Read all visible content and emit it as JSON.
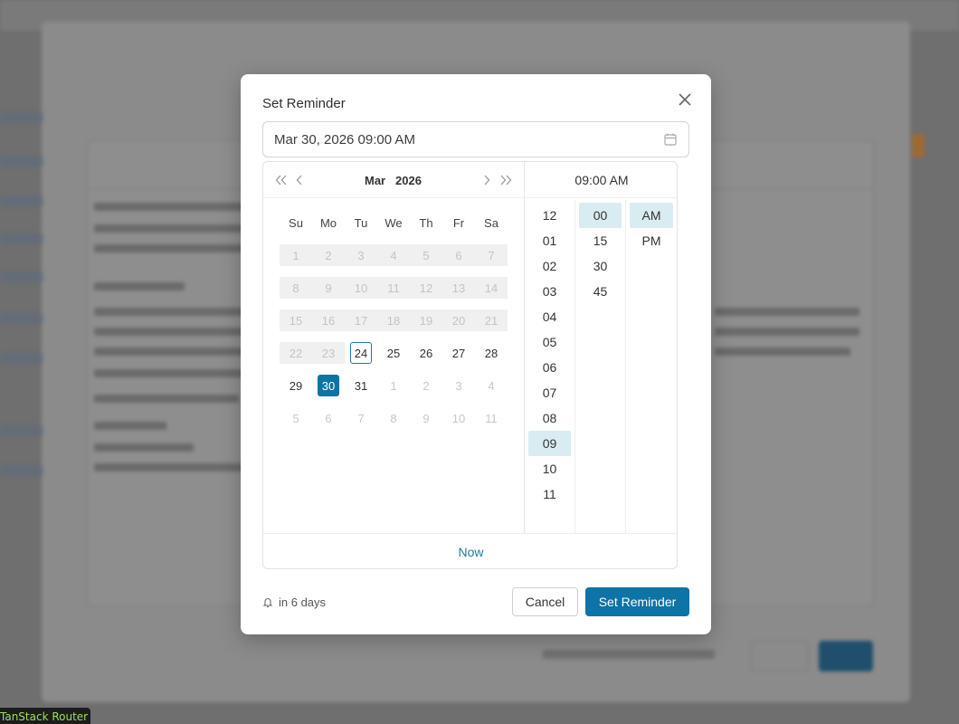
{
  "background": {
    "router_badge": "TanStack Router"
  },
  "dialog": {
    "title": "Set Reminder",
    "date_value": "Mar 30, 2026 09:00 AM",
    "calendar": {
      "month": "Mar",
      "year": "2026",
      "weekdays": [
        "Su",
        "Mo",
        "Tu",
        "We",
        "Th",
        "Fr",
        "Sa"
      ],
      "days": [
        {
          "d": "1",
          "state": "disabled"
        },
        {
          "d": "2",
          "state": "disabled"
        },
        {
          "d": "3",
          "state": "disabled"
        },
        {
          "d": "4",
          "state": "disabled"
        },
        {
          "d": "5",
          "state": "disabled"
        },
        {
          "d": "6",
          "state": "disabled"
        },
        {
          "d": "7",
          "state": "disabled"
        },
        {
          "d": "8",
          "state": "disabled"
        },
        {
          "d": "9",
          "state": "disabled"
        },
        {
          "d": "10",
          "state": "disabled"
        },
        {
          "d": "11",
          "state": "disabled"
        },
        {
          "d": "12",
          "state": "disabled"
        },
        {
          "d": "13",
          "state": "disabled"
        },
        {
          "d": "14",
          "state": "disabled"
        },
        {
          "d": "15",
          "state": "disabled"
        },
        {
          "d": "16",
          "state": "disabled"
        },
        {
          "d": "17",
          "state": "disabled"
        },
        {
          "d": "18",
          "state": "disabled"
        },
        {
          "d": "19",
          "state": "disabled"
        },
        {
          "d": "20",
          "state": "disabled"
        },
        {
          "d": "21",
          "state": "disabled"
        },
        {
          "d": "22",
          "state": "disabled"
        },
        {
          "d": "23",
          "state": "disabled"
        },
        {
          "d": "24",
          "state": "today"
        },
        {
          "d": "25",
          "state": "normal"
        },
        {
          "d": "26",
          "state": "normal"
        },
        {
          "d": "27",
          "state": "normal"
        },
        {
          "d": "28",
          "state": "normal"
        },
        {
          "d": "29",
          "state": "normal"
        },
        {
          "d": "30",
          "state": "selected"
        },
        {
          "d": "31",
          "state": "normal"
        },
        {
          "d": "1",
          "state": "outside"
        },
        {
          "d": "2",
          "state": "outside"
        },
        {
          "d": "3",
          "state": "outside"
        },
        {
          "d": "4",
          "state": "outside"
        },
        {
          "d": "5",
          "state": "outside"
        },
        {
          "d": "6",
          "state": "outside"
        },
        {
          "d": "7",
          "state": "outside"
        },
        {
          "d": "8",
          "state": "outside"
        },
        {
          "d": "9",
          "state": "outside"
        },
        {
          "d": "10",
          "state": "outside"
        },
        {
          "d": "11",
          "state": "outside"
        }
      ]
    },
    "time": {
      "header": "09:00 AM",
      "hours": [
        "12",
        "01",
        "02",
        "03",
        "04",
        "05",
        "06",
        "07",
        "08",
        "09",
        "10",
        "11"
      ],
      "selected_hour": "09",
      "minutes": [
        "00",
        "15",
        "30",
        "45"
      ],
      "selected_minute": "00",
      "periods": [
        "AM",
        "PM"
      ],
      "selected_period": "AM"
    },
    "now_label": "Now",
    "relative_text": "in 6 days",
    "cancel_label": "Cancel",
    "submit_label": "Set Reminder"
  },
  "colors": {
    "primary": "#0e73a6",
    "selected_time_bg": "#d9ecf1",
    "disabled_day_bg": "#f0f0f0"
  }
}
